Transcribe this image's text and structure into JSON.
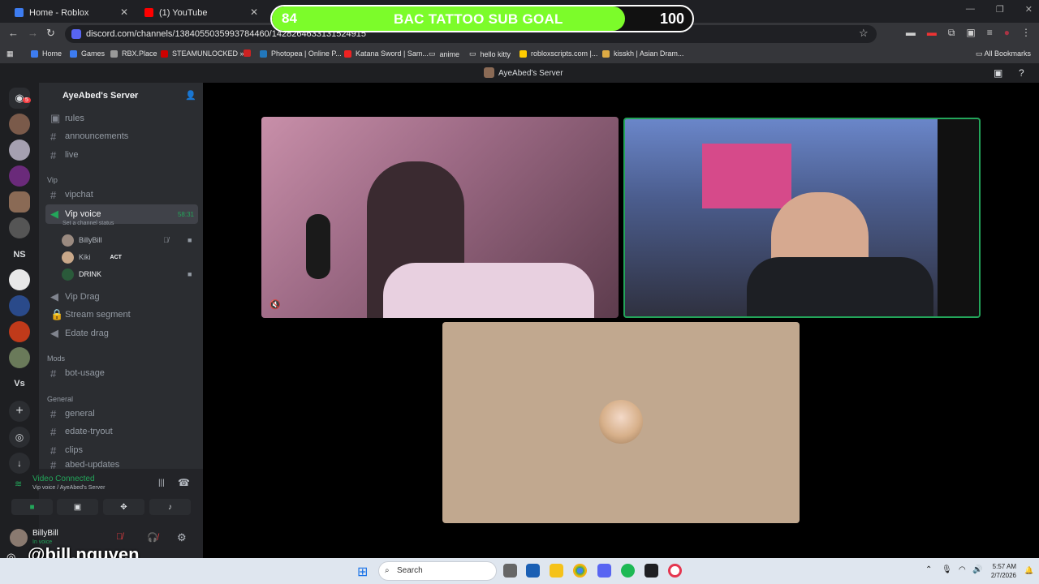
{
  "browser": {
    "tabs": [
      {
        "title": "Home - Roblox"
      },
      {
        "title": "(1) YouTube"
      }
    ],
    "url": "discord.com/channels/1384055035993784460/1428264633131524915",
    "bookmarks": [
      "Home",
      "Games",
      "RBX.Place",
      "STEAMUNLOCKED »...",
      "Photopea | Online P...",
      "Katana Sword | Sam...",
      "anime",
      "hello kitty",
      "robloxscripts.com |...",
      "kisskh | Asian Dram..."
    ],
    "all_bookmarks": "All Bookmarks"
  },
  "overlay": {
    "goal_current": "84",
    "goal_title": "BAC TATTOO SUB GOAL",
    "goal_max": "100",
    "goal_fraction": 0.84,
    "watermark": "@bill.nguyen"
  },
  "discord": {
    "window_title": "AyeAbed's Server",
    "server_name": "AyeAbed's Server",
    "rail_labels": [
      "NS",
      "Vs"
    ],
    "notification_count": "5",
    "channels_top": [
      {
        "name": "rules"
      },
      {
        "name": "announcements"
      },
      {
        "name": "live"
      }
    ],
    "category_vip": "Vip",
    "vip_channels": {
      "vipchat": "vipchat",
      "vip_voice": "Vip voice",
      "vip_voice_timer": "58:31",
      "channel_status": "Set a channel status",
      "vip_drag": "Vip Drag",
      "stream_segment": "Stream segment",
      "edate_drag": "Edate drag"
    },
    "voice_users": [
      {
        "name": "BillyBill"
      },
      {
        "name": "Kiki"
      },
      {
        "name": "DRINK"
      }
    ],
    "kiki_tag": "ACT",
    "category_mods": "Mods",
    "bot_usage": "bot-usage",
    "category_general": "General",
    "general_channels": [
      "general",
      "edate-tryout",
      "clips",
      "abed-updates"
    ],
    "voice_status": "Video Connected",
    "voice_location": "Vip voice / AyeAbed's Server",
    "current_user": "BillyBill",
    "current_user_status": "In voice"
  },
  "taskbar": {
    "search_placeholder": "Search",
    "time": "5:57 AM",
    "date": "2/7/2026"
  },
  "colors": {
    "goal_fill": "#7cfc2a",
    "discord_green": "#23a55a",
    "blurple": "#5865f2"
  }
}
